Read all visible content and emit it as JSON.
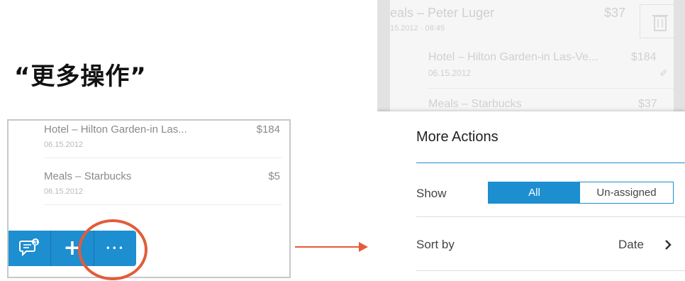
{
  "heading": "“更多操作”",
  "left_list": [
    {
      "title": "Hotel – Hilton Garden-in Las...",
      "date": "06.15.2012",
      "amount": "$184"
    },
    {
      "title": "Meals – Starbucks",
      "date": "06.15.2012",
      "amount": "$5"
    }
  ],
  "toolbar": {
    "badge_count": "3",
    "plus_label": "+",
    "more_label": "•••"
  },
  "background_list": [
    {
      "title": "eals – Peter Luger",
      "date": "15.2012 · 08:45",
      "amount": "$37"
    },
    {
      "title": "Hotel – Hilton Garden-in Las-Ve...",
      "date": "06.15.2012",
      "amount": "$184"
    },
    {
      "title": "Meals – Starbucks",
      "date": "",
      "amount": "$37"
    }
  ],
  "sheet": {
    "title": "More Actions",
    "show_label": "Show",
    "show_options": [
      "All",
      "Un-assigned"
    ],
    "show_selected": "All",
    "sort_label": "Sort by",
    "sort_value": "Date"
  },
  "colors": {
    "accent": "#1d8ed0",
    "highlight": "#e25c3a"
  }
}
